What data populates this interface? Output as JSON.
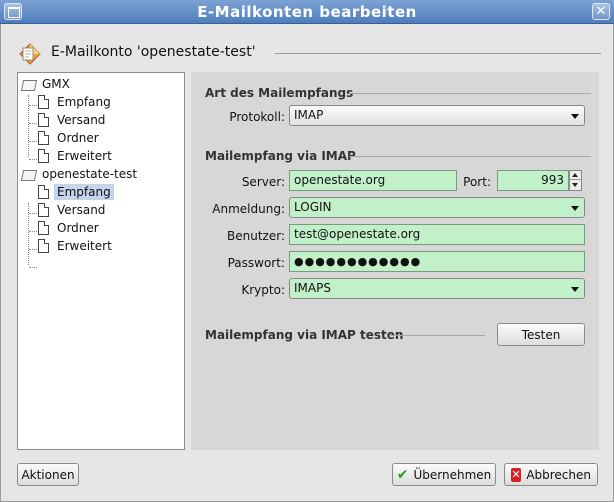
{
  "window": {
    "title": "E-Mailkonten bearbeiten"
  },
  "header": {
    "title": "E-Mailkonto 'openestate-test'"
  },
  "tree": {
    "accounts": [
      {
        "name": "GMX",
        "items": [
          "Empfang",
          "Versand",
          "Ordner",
          "Erweitert"
        ]
      },
      {
        "name": "openestate-test",
        "items": [
          "Empfang",
          "Versand",
          "Ordner",
          "Erweitert"
        ]
      }
    ],
    "selected": "openestate-test / Empfang"
  },
  "section_mail_type": {
    "title": "Art des Mailempfangs",
    "protocol_label": "Protokoll:",
    "protocol_value": "IMAP"
  },
  "section_imap": {
    "title": "Mailempfang via IMAP",
    "server_label": "Server:",
    "server_value": "openestate.org",
    "port_label": "Port:",
    "port_value": "993",
    "login_label": "Anmeldung:",
    "login_value": "LOGIN",
    "user_label": "Benutzer:",
    "user_value": "test@openestate.org",
    "password_label": "Passwort:",
    "password_value": "●●●●●●●●●●●●",
    "crypto_label": "Krypto:",
    "crypto_value": "IMAPS"
  },
  "section_test": {
    "title": "Mailempfang via IMAP testen",
    "test_button": "Testen"
  },
  "footer": {
    "actions_button": "Aktionen",
    "apply_button": "Übernehmen",
    "cancel_button": "Abbrechen"
  },
  "colors": {
    "field_bg": "#c2f0c9",
    "titlebar": "#5f8ac6",
    "selection": "#c4d4ea"
  }
}
